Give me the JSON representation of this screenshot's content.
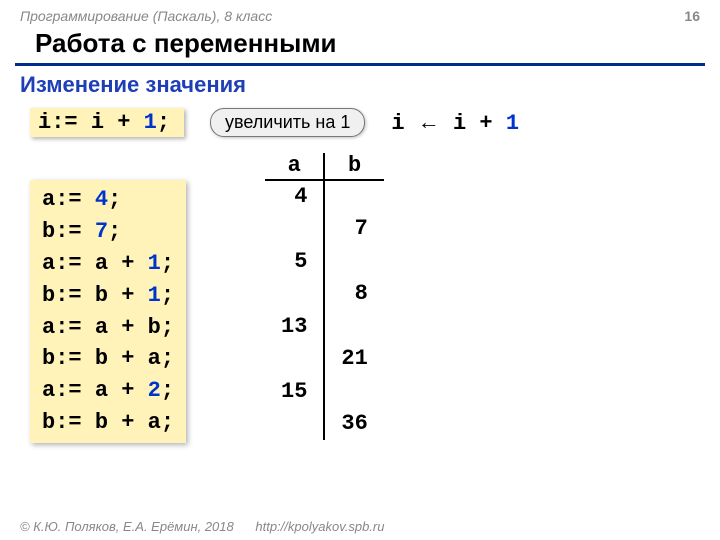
{
  "header": {
    "breadcrumb": "Программирование (Паскаль), 8 класс",
    "page_number": "16",
    "title": "Работа с переменными",
    "subtitle": "Изменение значения"
  },
  "example1": {
    "tokens": [
      "i",
      ":= ",
      "i",
      " + ",
      "1",
      ";"
    ],
    "callout": "увеличить на 1",
    "pseudo_tokens": [
      "i ",
      "←",
      " i + ",
      "1"
    ]
  },
  "code_block_lines": [
    [
      [
        "a",
        0
      ],
      [
        ":= ",
        0
      ],
      [
        "4",
        1
      ],
      [
        ";",
        0
      ]
    ],
    [
      [
        "b",
        0
      ],
      [
        ":= ",
        0
      ],
      [
        "7",
        1
      ],
      [
        ";",
        0
      ]
    ],
    [
      [
        "a",
        0
      ],
      [
        ":= ",
        0
      ],
      [
        "a",
        0
      ],
      [
        " + ",
        0
      ],
      [
        "1",
        1
      ],
      [
        ";",
        0
      ]
    ],
    [
      [
        "b",
        0
      ],
      [
        ":= ",
        0
      ],
      [
        "b",
        0
      ],
      [
        " + ",
        0
      ],
      [
        "1",
        1
      ],
      [
        ";",
        0
      ]
    ],
    [
      [
        "a",
        0
      ],
      [
        ":= ",
        0
      ],
      [
        "a",
        0
      ],
      [
        " + ",
        0
      ],
      [
        "b",
        0
      ],
      [
        ";",
        0
      ]
    ],
    [
      [
        "b",
        0
      ],
      [
        ":= ",
        0
      ],
      [
        "b",
        0
      ],
      [
        " + ",
        0
      ],
      [
        "a",
        0
      ],
      [
        ";",
        0
      ]
    ],
    [
      [
        "a",
        0
      ],
      [
        ":= ",
        0
      ],
      [
        "a",
        0
      ],
      [
        " + ",
        0
      ],
      [
        "2",
        1
      ],
      [
        ";",
        0
      ]
    ],
    [
      [
        "b",
        0
      ],
      [
        ":= ",
        0
      ],
      [
        "b",
        0
      ],
      [
        " + ",
        0
      ],
      [
        "a",
        0
      ],
      [
        ";",
        0
      ]
    ]
  ],
  "trace": {
    "headers": [
      "a",
      "b"
    ],
    "rows": [
      {
        "a": "4",
        "b": ""
      },
      {
        "a": "",
        "b": "7"
      },
      {
        "a": "5",
        "b": ""
      },
      {
        "a": "",
        "b": "8"
      },
      {
        "a": "13",
        "b": ""
      },
      {
        "a": "",
        "b": "21"
      },
      {
        "a": "15",
        "b": ""
      },
      {
        "a": "",
        "b": "36"
      }
    ]
  },
  "footer": {
    "copyright": "© К.Ю. Поляков, Е.А. Ерёмин, 2018",
    "url": "http://kpolyakov.spb.ru"
  }
}
